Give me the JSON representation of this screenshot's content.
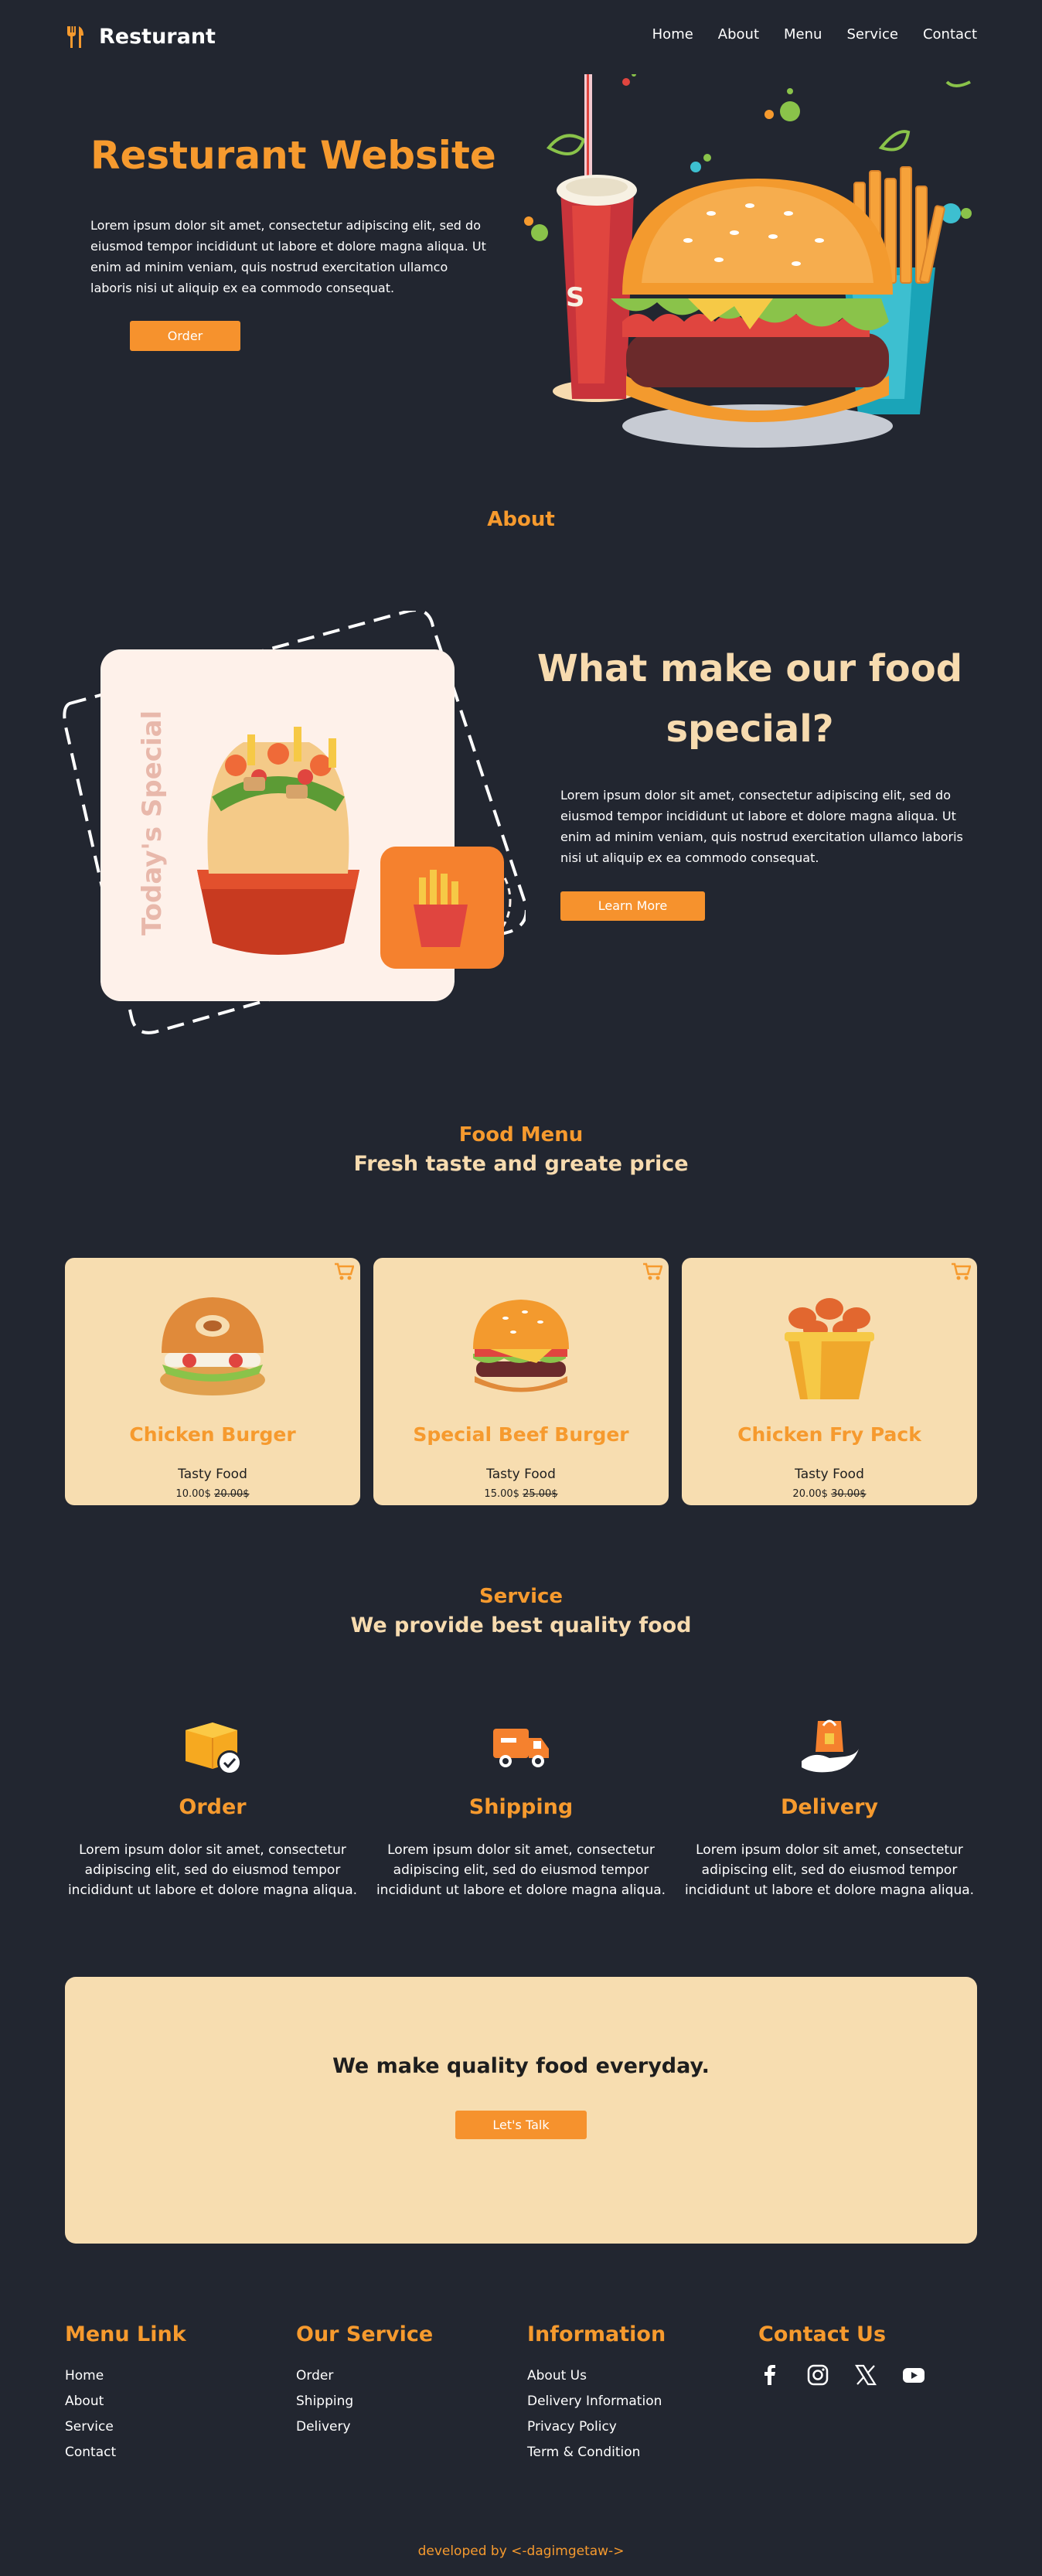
{
  "nav": {
    "brand": "Resturant",
    "brand_icon": "fork-knife-icon",
    "links": [
      "Home",
      "About",
      "Menu",
      "Service",
      "Contact"
    ]
  },
  "hero": {
    "title": "Resturant Website",
    "text": "Lorem ipsum dolor sit amet, consectetur adipiscing elit, sed do eiusmod tempor incididunt ut labore et dolore magna aliqua. Ut enim ad minim veniam, quis nostrud exercitation ullamco laboris nisi ut aliquip ex ea commodo consequat.",
    "button": "Order"
  },
  "about": {
    "label": "About",
    "card_text": "Today's Special",
    "heading": "What make our food special?",
    "text": "Lorem ipsum dolor sit amet, consectetur adipiscing elit, sed do eiusmod tempor incididunt ut labore et dolore magna aliqua. Ut enim ad minim veniam, quis nostrud exercitation ullamco laboris nisi ut aliquip ex ea commodo consequat.",
    "button": "Learn More"
  },
  "menu": {
    "label": "Food Menu",
    "subtitle": "Fresh taste and greate price",
    "items": [
      {
        "name": "Chicken Burger",
        "sub": "Tasty Food",
        "price": "10.00$",
        "old_price": "20.00$",
        "icon": "cart-icon"
      },
      {
        "name": "Special Beef Burger",
        "sub": "Tasty Food",
        "price": "15.00$",
        "old_price": "25.00$",
        "icon": "cart-icon"
      },
      {
        "name": "Chicken Fry Pack",
        "sub": "Tasty Food",
        "price": "20.00$",
        "old_price": "30.00$",
        "icon": "cart-icon"
      }
    ]
  },
  "service": {
    "label": "Service",
    "subtitle": "We provide best quality food",
    "items": [
      {
        "title": "Order",
        "text": "Lorem ipsum dolor sit amet, consectetur adipiscing elit, sed do eiusmod tempor incididunt ut labore et dolore magna aliqua.",
        "icon": "box-check-icon"
      },
      {
        "title": "Shipping",
        "text": "Lorem ipsum dolor sit amet, consectetur adipiscing elit, sed do eiusmod tempor incididunt ut labore et dolore magna aliqua.",
        "icon": "truck-icon"
      },
      {
        "title": "Delivery",
        "text": "Lorem ipsum dolor sit amet, consectetur adipiscing elit, sed do eiusmod tempor incididunt ut labore et dolore magna aliqua.",
        "icon": "hand-bag-icon"
      }
    ]
  },
  "cta": {
    "title": "We make quality food everyday.",
    "button": "Let's Talk"
  },
  "footer": {
    "menu": {
      "heading": "Menu Link",
      "links": [
        "Home",
        "About",
        "Service",
        "Contact"
      ]
    },
    "service": {
      "heading": "Our Service",
      "links": [
        "Order",
        "Shipping",
        "Delivery"
      ]
    },
    "info": {
      "heading": "Information",
      "links": [
        "About Us",
        "Delivery Information",
        "Privacy Policy",
        "Term & Condition"
      ]
    },
    "contact": {
      "heading": "Contact Us",
      "socials": [
        "facebook-icon",
        "instagram-icon",
        "x-icon",
        "youtube-icon"
      ]
    },
    "credit": "developed by <-dagimgetaw->"
  },
  "colors": {
    "background": "#222630",
    "accent": "#f69a2e",
    "cream": "#f7ddb0"
  }
}
